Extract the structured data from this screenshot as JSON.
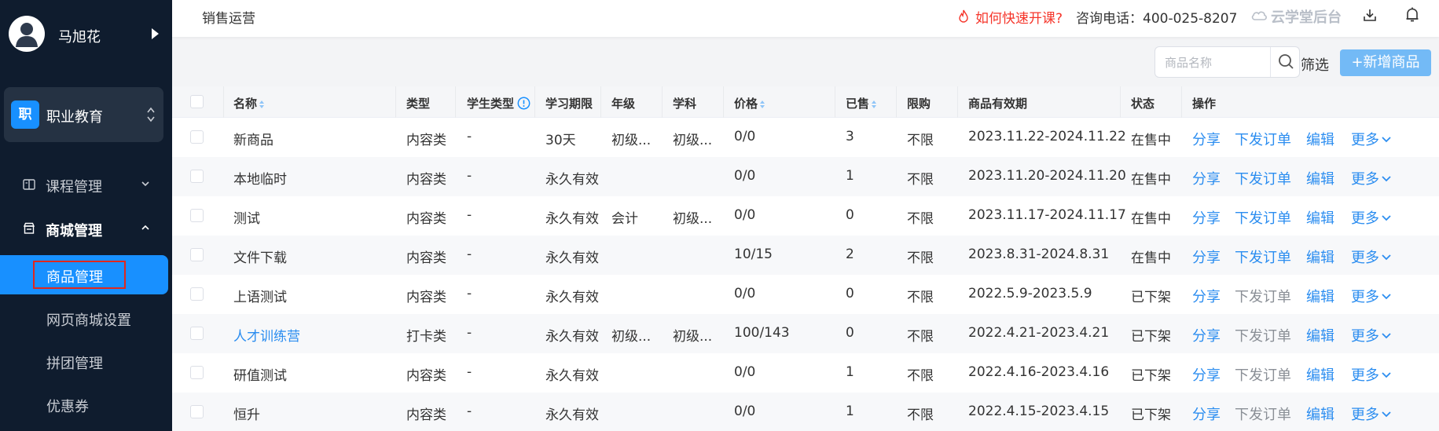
{
  "sidebar": {
    "user_name": "马旭花",
    "org_badge": "职",
    "org_name": "职业教育",
    "groups": [
      {
        "label": "课程管理",
        "expanded": false
      },
      {
        "label": "商城管理",
        "expanded": true
      }
    ],
    "items": [
      {
        "label": "商品管理",
        "active": true
      },
      {
        "label": "网页商城设置",
        "active": false
      },
      {
        "label": "拼团管理",
        "active": false
      },
      {
        "label": "优惠券",
        "active": false
      }
    ]
  },
  "header": {
    "breadcrumb": "销售运营",
    "help_link": "如何快速开课?",
    "phone": "咨询电话：400-025-8207",
    "brand": "云学堂后台"
  },
  "toolbar": {
    "search_placeholder": "商品名称",
    "filter_label": "筛选",
    "add_label": "+新增商品"
  },
  "table": {
    "columns": [
      "名称",
      "类型",
      "学生类型",
      "学习期限",
      "年级",
      "学科",
      "价格",
      "已售",
      "限购",
      "商品有效期",
      "状态",
      "操作"
    ],
    "actions": {
      "share": "分享",
      "order": "下发订单",
      "edit": "编辑",
      "more": "更多"
    },
    "rows": [
      {
        "name": "新商品",
        "type": "内容类",
        "student_type": "-",
        "period": "30天",
        "grade": "初级...",
        "subject": "初级...",
        "price": "0/0",
        "sold": "3",
        "limit": "不限",
        "validity": "2023.11.22-2024.11.22",
        "status": "在售中"
      },
      {
        "name": "本地临时",
        "type": "内容类",
        "student_type": "-",
        "period": "永久有效",
        "grade": "",
        "subject": "",
        "price": "0/0",
        "sold": "1",
        "limit": "不限",
        "validity": "2023.11.20-2024.11.20",
        "status": "在售中"
      },
      {
        "name": "测试",
        "type": "内容类",
        "student_type": "-",
        "period": "永久有效",
        "grade": "会计",
        "subject": "初级...",
        "price": "0/0",
        "sold": "0",
        "limit": "不限",
        "validity": "2023.11.17-2024.11.17",
        "status": "在售中"
      },
      {
        "name": "文件下载",
        "type": "内容类",
        "student_type": "-",
        "period": "永久有效",
        "grade": "",
        "subject": "",
        "price": "10/15",
        "sold": "2",
        "limit": "不限",
        "validity": "2023.8.31-2024.8.31",
        "status": "在售中"
      },
      {
        "name": "上语测试",
        "type": "内容类",
        "student_type": "-",
        "period": "永久有效",
        "grade": "",
        "subject": "",
        "price": "0/0",
        "sold": "0",
        "limit": "不限",
        "validity": "2022.5.9-2023.5.9",
        "status": "已下架"
      },
      {
        "name": "人才训练营",
        "type": "打卡类",
        "student_type": "-",
        "period": "永久有效",
        "grade": "初级...",
        "subject": "初级...",
        "price": "100/143",
        "sold": "0",
        "limit": "不限",
        "validity": "2022.4.21-2023.4.21",
        "status": "已下架"
      },
      {
        "name": "研值测试",
        "type": "内容类",
        "student_type": "-",
        "period": "永久有效",
        "grade": "",
        "subject": "",
        "price": "0/0",
        "sold": "1",
        "limit": "不限",
        "validity": "2022.4.16-2023.4.16",
        "status": "已下架"
      },
      {
        "name": "恒升",
        "type": "内容类",
        "student_type": "-",
        "period": "永久有效",
        "grade": "",
        "subject": "",
        "price": "0/0",
        "sold": "1",
        "limit": "不限",
        "validity": "2022.4.15-2023.4.15",
        "status": "已下架"
      }
    ]
  },
  "colors": {
    "sidebar_bg": "#0f1c2e",
    "accent": "#1890ff",
    "link": "#2b8df0",
    "help_red": "#f5352a",
    "add_button": "#73baf6",
    "highlight_box": "#e0281e"
  }
}
